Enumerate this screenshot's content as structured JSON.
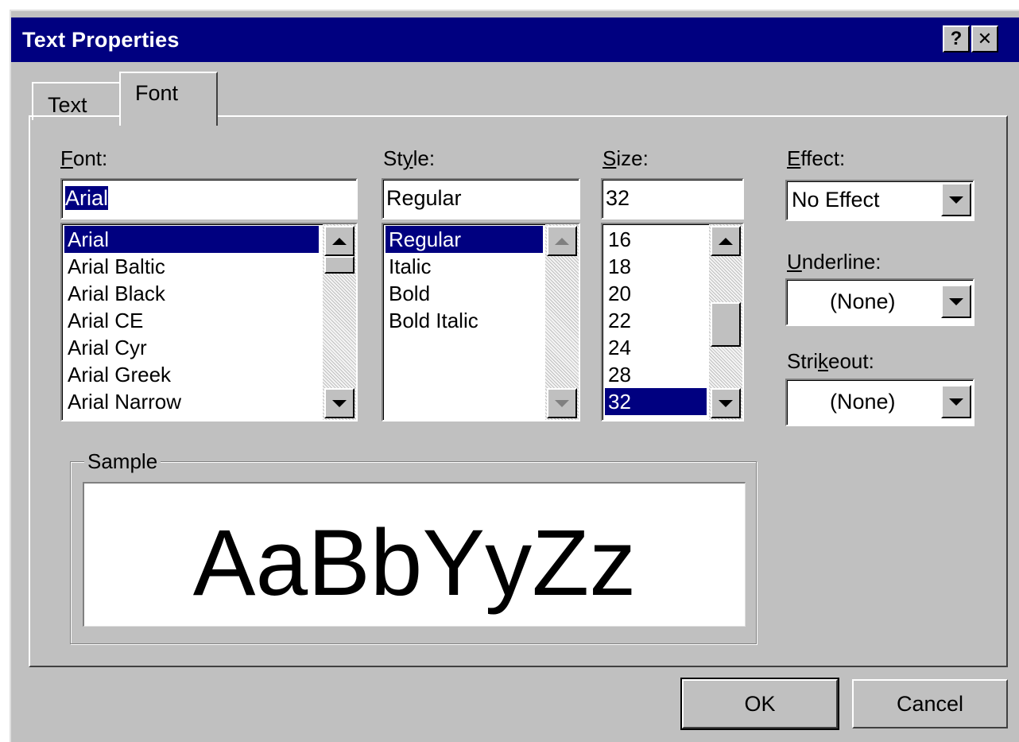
{
  "window": {
    "title": "Text Properties",
    "help_glyph": "?",
    "close_glyph": "✕"
  },
  "tabs": [
    {
      "label": "Text",
      "selected": false
    },
    {
      "label": "Font",
      "selected": true
    }
  ],
  "font": {
    "label_mnemonic": "F",
    "label_rest": "ont:",
    "value": "Arial",
    "items": [
      "Arial",
      "Arial Baltic",
      "Arial Black",
      "Arial CE",
      "Arial Cyr",
      "Arial Greek",
      "Arial Narrow"
    ],
    "selected_index": 0
  },
  "style": {
    "label_pre": "St",
    "label_mnemonic": "y",
    "label_rest": "le:",
    "value": "Regular",
    "items": [
      "Regular",
      "Italic",
      "Bold",
      "Bold Italic"
    ],
    "selected_index": 0
  },
  "size": {
    "label_mnemonic": "S",
    "label_rest": "ize:",
    "value": "32",
    "items": [
      "16",
      "18",
      "20",
      "22",
      "24",
      "28",
      "32"
    ],
    "selected_index": 6
  },
  "effect": {
    "label_mnemonic": "E",
    "label_rest": "ffect:",
    "value": "No Effect"
  },
  "underline": {
    "label_mnemonic": "U",
    "label_rest": "nderline:",
    "value": "(None)"
  },
  "strikeout": {
    "label_pre": "Stri",
    "label_mnemonic": "k",
    "label_rest": "eout:",
    "value": "(None)"
  },
  "sample": {
    "label": "Sample",
    "text": "AaBbYyZz"
  },
  "buttons": {
    "ok": "OK",
    "cancel": "Cancel"
  },
  "colors": {
    "titlebar": "#000080",
    "face": "#c0c0c0",
    "selection": "#000080"
  }
}
